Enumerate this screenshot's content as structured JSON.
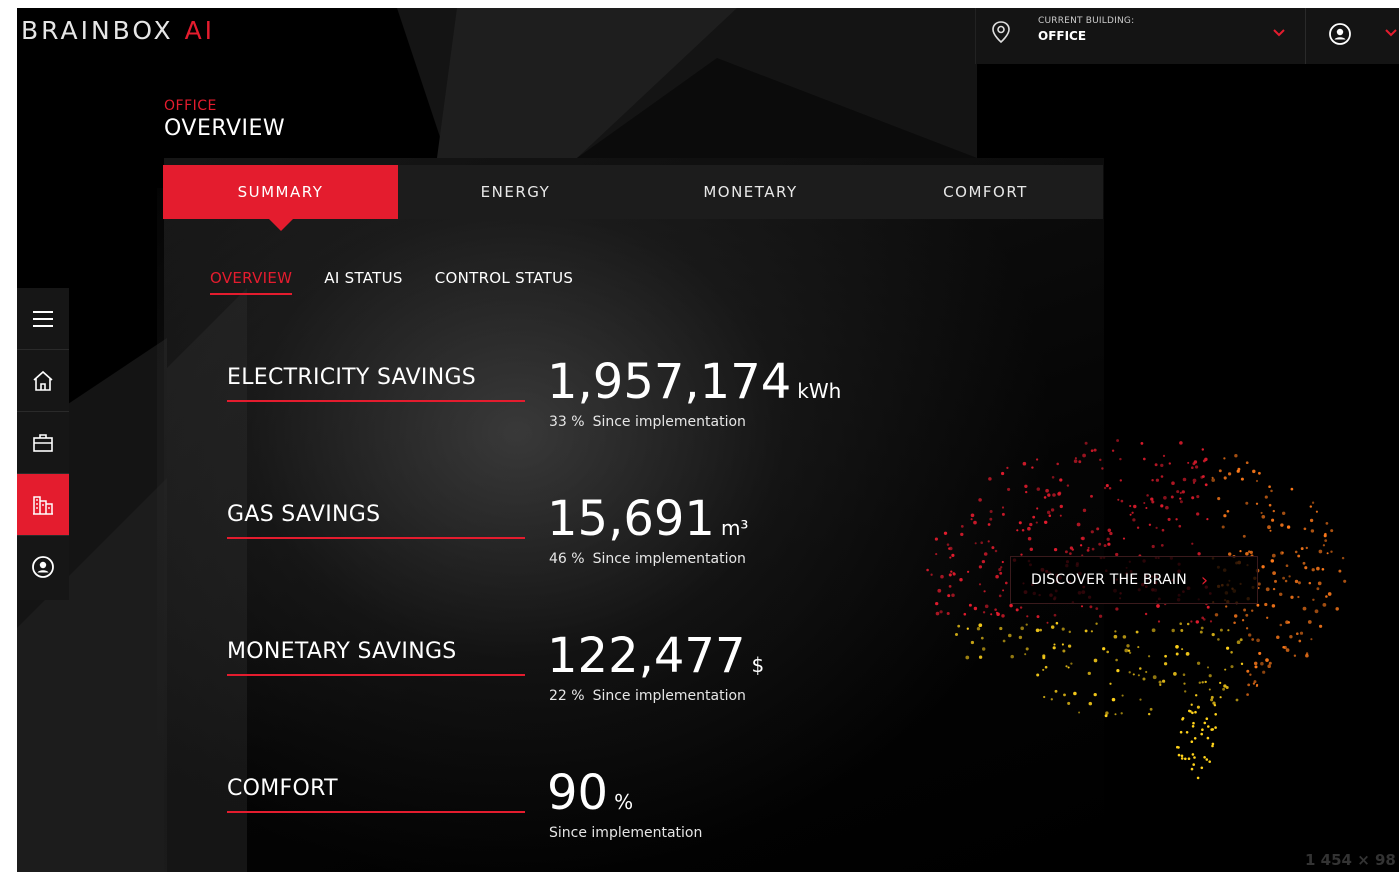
{
  "logo": {
    "text": "BRAINBOX ",
    "accent": "AI"
  },
  "building": {
    "label": "CURRENT BUILDING:",
    "value": "OFFICE"
  },
  "breadcrumb": {
    "site": "OFFICE"
  },
  "page_title": "OVERVIEW",
  "tabs": [
    {
      "label": "SUMMARY",
      "active": true
    },
    {
      "label": "ENERGY",
      "active": false
    },
    {
      "label": "MONETARY",
      "active": false
    },
    {
      "label": "COMFORT",
      "active": false
    }
  ],
  "subtabs": [
    {
      "label": "OVERVIEW",
      "active": true
    },
    {
      "label": "AI STATUS",
      "active": false
    },
    {
      "label": "CONTROL STATUS",
      "active": false
    }
  ],
  "sidenav": [
    {
      "icon": "menu-icon"
    },
    {
      "icon": "home-icon"
    },
    {
      "icon": "briefcase-icon"
    },
    {
      "icon": "buildings-icon",
      "active": true
    },
    {
      "icon": "user-icon"
    }
  ],
  "metrics": [
    {
      "label": "ELECTRICITY SAVINGS",
      "value": "1,957,174",
      "unit": "kWh",
      "pct": "33 %",
      "since": "Since implementation"
    },
    {
      "label": "GAS SAVINGS",
      "value": "15,691",
      "unit": "m³",
      "pct": "46 %",
      "since": "Since implementation"
    },
    {
      "label": "MONETARY SAVINGS",
      "value": "122,477",
      "unit": "$",
      "pct": "22 %",
      "since": "Since implementation"
    },
    {
      "label": "COMFORT",
      "value": "90",
      "unit": "%",
      "pct": "",
      "since": "Since implementation"
    }
  ],
  "discover": {
    "label": "DISCOVER THE BRAIN",
    "arrow": "›"
  },
  "image_size_caption": "1 454 × 98",
  "colors": {
    "accent": "#e41c2e",
    "background": "#000000",
    "panel": "#1c1c1c",
    "brain_hot": "#e41c2e",
    "brain_warm": "#ff7a1a",
    "brain_cool": "#ffd21a"
  }
}
